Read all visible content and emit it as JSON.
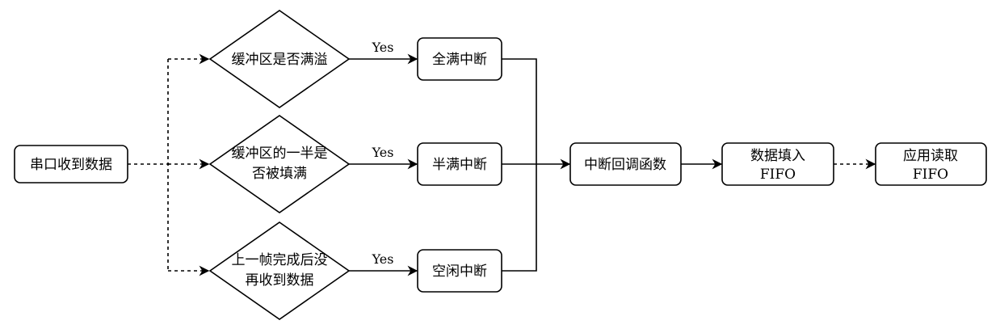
{
  "nodes": {
    "serial_receive": "串口收到数据",
    "decision_buffer_full": "缓冲区是否满溢",
    "decision_half_full_line1": "缓冲区的一半是",
    "decision_half_full_line2": "否被填满",
    "decision_idle_line1": "上一帧完成后没",
    "decision_idle_line2": "再收到数据",
    "full_interrupt": "全满中断",
    "half_interrupt": "半满中断",
    "idle_interrupt": "空闲中断",
    "callback": "中断回调函数",
    "fill_fifo_line1": "数据填入",
    "fill_fifo_line2": "FIFO",
    "app_read_line1": "应用读取",
    "app_read_line2": "FIFO"
  },
  "edge_labels": {
    "yes_full": "Yes",
    "yes_half": "Yes",
    "yes_idle": "Yes"
  }
}
